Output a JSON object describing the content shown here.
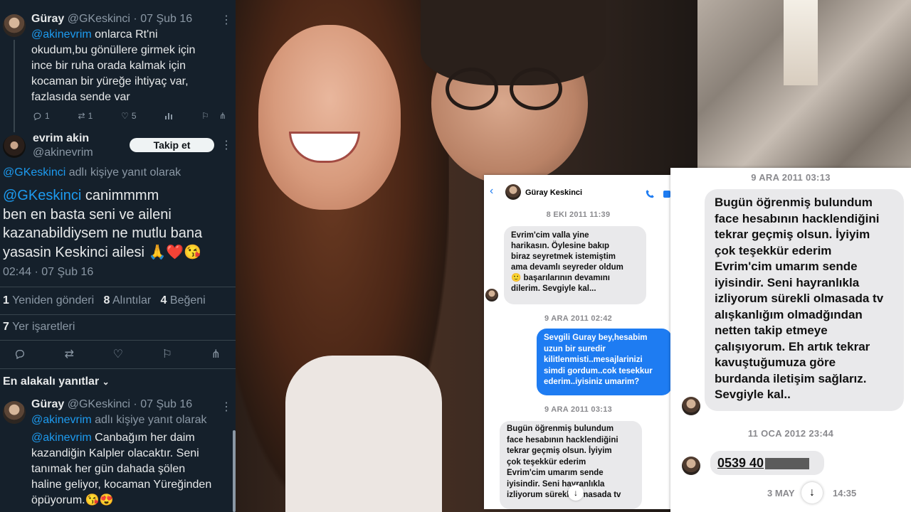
{
  "tweet1": {
    "name": "Güray",
    "handle": "@GKeskinci",
    "date": "· 07 Şub 16",
    "mention": "@akinevrim",
    "lines": [
      " onlarca Rt'ni",
      "okudum,bu gönüllere girmek için",
      "ince bir ruha orada kalmak için",
      "kocaman bir yüreğe ihtiyaç var,",
      "fazlasıda sende var"
    ],
    "replies": "1",
    "retweets": "1",
    "likes": "5"
  },
  "main_tweet": {
    "name": "evrim akin",
    "handle": "@akinevrim",
    "follow_label": "Takip et",
    "reply_to_handle": "@GKeskinci",
    "reply_to_text": " adlı kişiye yanıt olarak",
    "mention": "@GKeskinci",
    "first_line_rest": " canimmmm",
    "lines": [
      "ben en basta seni ve aileni",
      "kazanabildiysem ne mutlu bana",
      "yasasin Keskinci ailesi 🙏❤️😘"
    ],
    "timestamp": "02:44 · 07 Şub 16",
    "reposts_count": "1",
    "reposts_label": " Yeniden gönderi",
    "quotes_count": "8",
    "quotes_label": " Alıntılar",
    "likes_count": "4",
    "likes_label": " Beğeni",
    "bookmarks_count": "7",
    "bookmarks_label": " Yer işaretleri"
  },
  "replies_filter": "En alakalı yanıtlar",
  "tweet3": {
    "name": "Güray",
    "handle": "@GKeskinci",
    "date": "· 07 Şub 16",
    "reply_to_handle": "@akinevrim",
    "reply_to_text": " adlı kişiye yanıt olarak",
    "mention": "@akinevrim",
    "first_line_rest": " Canbağım her daim",
    "lines": [
      "kazandiğin Kalpler olacaktır. Seni",
      "tanımak her gün dahada şölen",
      "haline geliyor, kocaman Yüreğinden",
      "öpüyorum.😘😍"
    ]
  },
  "chat1": {
    "contact": "Güray Keskinci",
    "ts1": "8 EKI 2011 11:39",
    "msg1": [
      "Evrim'cim valla yine",
      "harikasın. Öylesine bakıp",
      "biraz seyretmek istemiştim",
      "ama devamlı seyreder oldum",
      "🙂 başarılarının devamını",
      "dilerim. Sevgiyle kal..."
    ],
    "ts2": "9 ARA 2011 02:42",
    "msg2": [
      "Sevgili Guray bey,hesabim",
      "uzun bir suredir",
      "kilitlenmisti..mesajlarinizi",
      "simdi gordum..cok tesekkur",
      "ederim..iyisiniz umarim?"
    ],
    "ts3": "9 ARA 2011 03:13",
    "msg3": [
      "Bugün öğrenmiş bulundum",
      "face hesabının hacklendiğini",
      "tekrar geçmiş olsun.  İyiyim",
      "çok teşekkür ederim",
      "Evrim'cim umarım sende",
      "iyisindir. Seni hayranlıkla",
      "izliyorum sürekli olmasada tv"
    ]
  },
  "chat2": {
    "ts1": "9 ARA 2011 03:13",
    "msg1": [
      "Bugün öğrenmiş bulundum",
      "face hesabının hacklendiğini",
      "tekrar geçmiş olsun.  İyiyim",
      "çok teşekkür ederim",
      "Evrim'cim umarım sende",
      "iyisindir. Seni hayranlıkla",
      "izliyorum sürekli olmasada tv",
      "alışkanlığım olmadğından",
      "netten takip etmeye",
      "çalışıyorum. Eh artık tekrar",
      "kavuştuğumuza göre",
      "burdanda iletişim sağlarız.",
      "Sevgiyle kal.."
    ],
    "ts2": "11 OCA 2012 23:44",
    "phone": "0539 40",
    "ts3_left": "3 MAY",
    "ts3_right": "14:35"
  },
  "colors": {
    "twitter_bg": "#15202b",
    "link": "#1d9bf0",
    "bubble_out": "#1e7cf2",
    "bubble_in": "#e9e9eb"
  }
}
